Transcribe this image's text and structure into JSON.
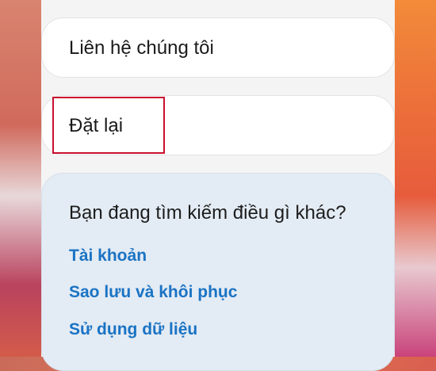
{
  "cards": {
    "contact_label": "Liên hệ chúng tôi",
    "reset_label": "Đặt lại"
  },
  "panel": {
    "title": "Bạn đang tìm kiếm điều gì khác?",
    "links": [
      "Tài khoản",
      "Sao lưu và khôi phục",
      "Sử dụng dữ liệu"
    ]
  },
  "colors": {
    "link": "#1a73c4",
    "highlight": "#c8102e",
    "panel_bg": "#e3ebf4"
  }
}
